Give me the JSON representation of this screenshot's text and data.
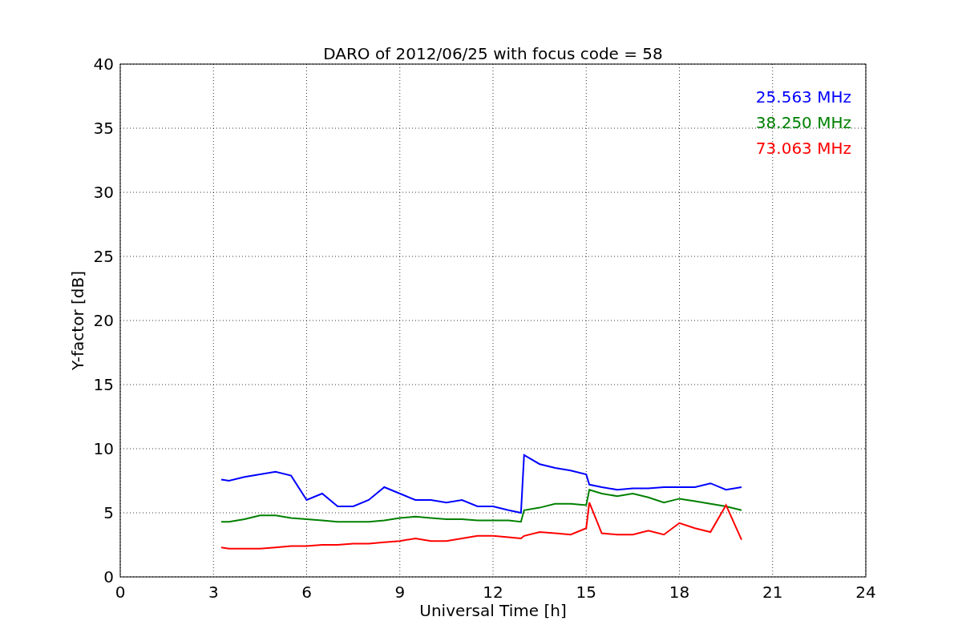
{
  "figure": {
    "chart_data": {
      "type": "line",
      "title": "DARO of 2012/06/25 with focus code = 58",
      "xlabel": "Universal Time [h]",
      "ylabel": "Y-factor [dB]",
      "x": [
        3.25,
        3.5,
        4,
        4.5,
        5,
        5.5,
        6,
        6.5,
        7,
        7.5,
        8,
        8.5,
        9,
        9.5,
        10,
        10.5,
        11,
        11.5,
        12,
        12.5,
        12.9,
        13,
        13.5,
        14,
        14.5,
        15,
        15.1,
        15.5,
        16,
        16.5,
        17,
        17.5,
        18,
        18.5,
        19,
        19.5,
        20
      ],
      "series": [
        {
          "name": "25.563 MHz",
          "color": "#0000ff",
          "values": [
            7.6,
            7.5,
            7.8,
            8.0,
            8.2,
            7.9,
            6,
            6.5,
            5.5,
            5.5,
            6,
            7,
            6.5,
            6,
            6,
            5.8,
            6,
            5.5,
            5.5,
            5.2,
            5.0,
            9.5,
            8.8,
            8.5,
            8.3,
            8.0,
            7.2,
            7.0,
            6.8,
            6.9,
            6.9,
            7.0,
            7.0,
            7.0,
            7.3,
            6.8,
            7.0
          ]
        },
        {
          "name": "38.250 MHz",
          "color": "#008000",
          "values": [
            4.3,
            4.3,
            4.5,
            4.8,
            4.8,
            4.6,
            4.5,
            4.4,
            4.3,
            4.3,
            4.3,
            4.4,
            4.6,
            4.7,
            4.6,
            4.5,
            4.5,
            4.4,
            4.4,
            4.4,
            4.3,
            5.2,
            5.4,
            5.7,
            5.7,
            5.6,
            6.8,
            6.5,
            6.3,
            6.5,
            6.2,
            5.8,
            6.1,
            5.9,
            5.7,
            5.5,
            5.2
          ]
        },
        {
          "name": "73.063 MHz",
          "color": "#ff0000",
          "values": [
            2.3,
            2.2,
            2.2,
            2.2,
            2.3,
            2.4,
            2.4,
            2.5,
            2.5,
            2.6,
            2.6,
            2.7,
            2.8,
            3.0,
            2.8,
            2.8,
            3.0,
            3.2,
            3.2,
            3.1,
            3.0,
            3.2,
            3.5,
            3.4,
            3.3,
            3.8,
            5.8,
            3.4,
            3.3,
            3.3,
            3.6,
            3.3,
            4.2,
            3.8,
            3.5,
            5.6,
            2.9
          ]
        }
      ],
      "xlim": [
        0,
        24
      ],
      "ylim": [
        0,
        40
      ],
      "xticks": [
        0,
        3,
        6,
        9,
        12,
        15,
        18,
        21,
        24
      ],
      "yticks": [
        0,
        5,
        10,
        15,
        20,
        25,
        30,
        35,
        40
      ],
      "grid": true
    }
  }
}
